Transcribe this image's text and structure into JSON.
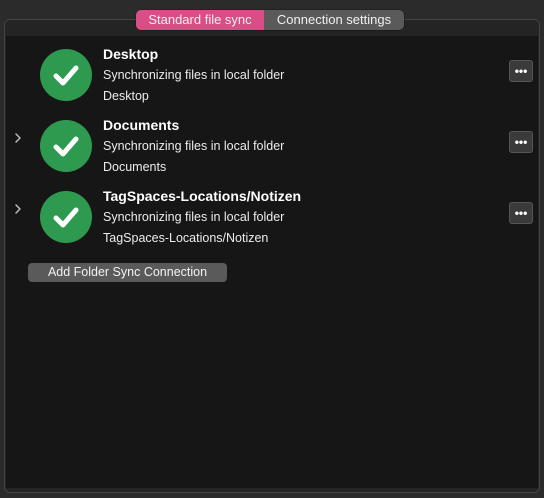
{
  "tabs": {
    "standard_file_sync": "Standard file sync",
    "connection_settings": "Connection settings",
    "active": "standard_file_sync",
    "active_color": "#d94e86"
  },
  "connections": [
    {
      "title": "Desktop",
      "status": "Synchronizing files in local folder",
      "path": "Desktop",
      "expandable": false,
      "status_icon": "checkmark-icon",
      "status_color": "#2e9a50",
      "more_label": "•••"
    },
    {
      "title": "Documents",
      "status": "Synchronizing files in local folder",
      "path": "Documents",
      "expandable": true,
      "status_icon": "checkmark-icon",
      "status_color": "#2e9a50",
      "more_label": "•••"
    },
    {
      "title": "TagSpaces-Locations/Notizen",
      "status": "Synchronizing files in local folder",
      "path": "TagSpaces-Locations/Notizen",
      "expandable": true,
      "status_icon": "checkmark-icon",
      "status_color": "#2e9a50",
      "more_label": "•••"
    }
  ],
  "add_button_label": "Add Folder Sync Connection"
}
